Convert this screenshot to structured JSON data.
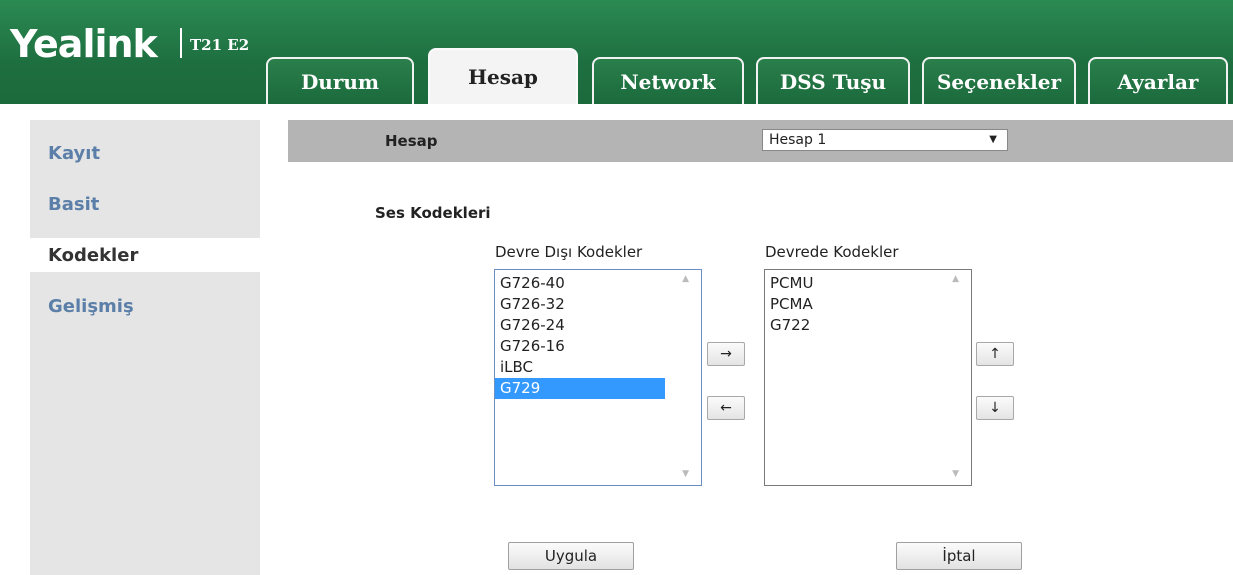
{
  "header": {
    "brand": "Yealink",
    "model": "T21 E2",
    "tabs": [
      "Durum",
      "Hesap",
      "Network",
      "DSS Tuşu",
      "Seçenekler",
      "Ayarlar"
    ],
    "active_tab": "Hesap"
  },
  "sidebar": {
    "items": [
      "Kayıt",
      "Basit",
      "Kodekler",
      "Gelişmiş"
    ],
    "active": "Kodekler"
  },
  "account_bar": {
    "label": "Hesap",
    "selected": "Hesap 1"
  },
  "codecs": {
    "section_title": "Ses Kodekleri",
    "disabled_title": "Devre Dışı Kodekler",
    "enabled_title": "Devrede Kodekler",
    "disabled": [
      "G726-40",
      "G726-32",
      "G726-24",
      "G726-16",
      "iLBC",
      "G729"
    ],
    "disabled_selected": "G729",
    "enabled": [
      "PCMU",
      "PCMA",
      "G722"
    ],
    "move_right": "→",
    "move_left": "←",
    "move_up": "↑",
    "move_down": "↓"
  },
  "actions": {
    "apply": "Uygula",
    "cancel": "İptal"
  },
  "colors": {
    "header_green": "#1e6f40",
    "sidebar_link": "#5b7fa8",
    "selection": "#3399ff"
  }
}
